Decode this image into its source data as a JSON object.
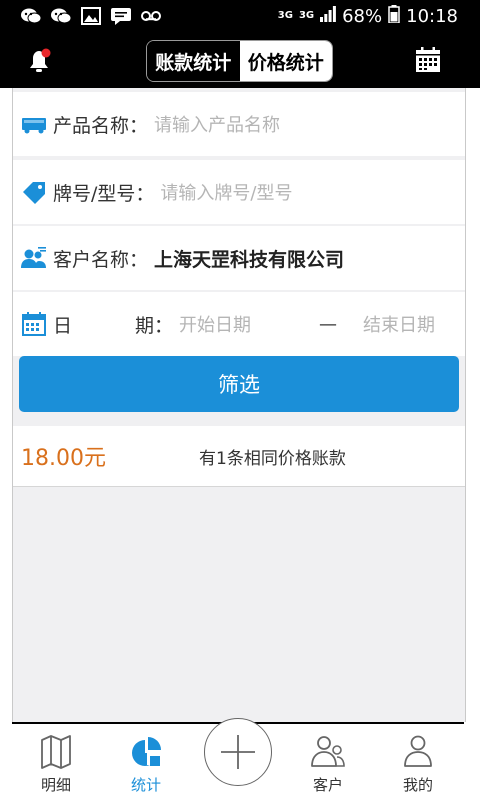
{
  "status_bar": {
    "net_label_1": "3G",
    "net_label_2": "3G",
    "battery": "68%",
    "time": "10:18",
    "icons": [
      "wechat-icon",
      "wechat-icon",
      "image-icon",
      "message-icon",
      "voicemail-icon",
      "signal-icon",
      "battery-icon"
    ]
  },
  "header": {
    "tabs": [
      {
        "label": "账款统计",
        "active": false
      },
      {
        "label": "价格统计",
        "active": true
      }
    ],
    "left_icon": "bell-icon",
    "right_icon": "calendar-icon"
  },
  "form": {
    "product": {
      "label": "产品名称：",
      "placeholder": "请输入产品名称"
    },
    "model": {
      "label": "牌号/型号：",
      "placeholder": "请输入牌号/型号"
    },
    "customer": {
      "label": "客户名称：",
      "value": "上海天罡科技有限公司"
    },
    "date": {
      "label_a": "日",
      "label_b": "期：",
      "start_placeholder": "开始日期",
      "separator": "—",
      "end_placeholder": "结束日期"
    },
    "filter_label": "筛选"
  },
  "result": {
    "price": "18.00元",
    "count_text": "有1条相同价格账款"
  },
  "tabbar": {
    "items": [
      {
        "label": "明细",
        "icon": "map-icon",
        "active": false
      },
      {
        "label": "统计",
        "icon": "pie-chart-icon",
        "active": true
      },
      {
        "label": "",
        "icon": "plus-icon",
        "active": false
      },
      {
        "label": "客户",
        "icon": "customers-icon",
        "active": false
      },
      {
        "label": "我的",
        "icon": "user-icon",
        "active": false
      }
    ]
  },
  "colors": {
    "accent": "#1b8fd8",
    "price": "#d9701c",
    "bar": "#000000"
  }
}
